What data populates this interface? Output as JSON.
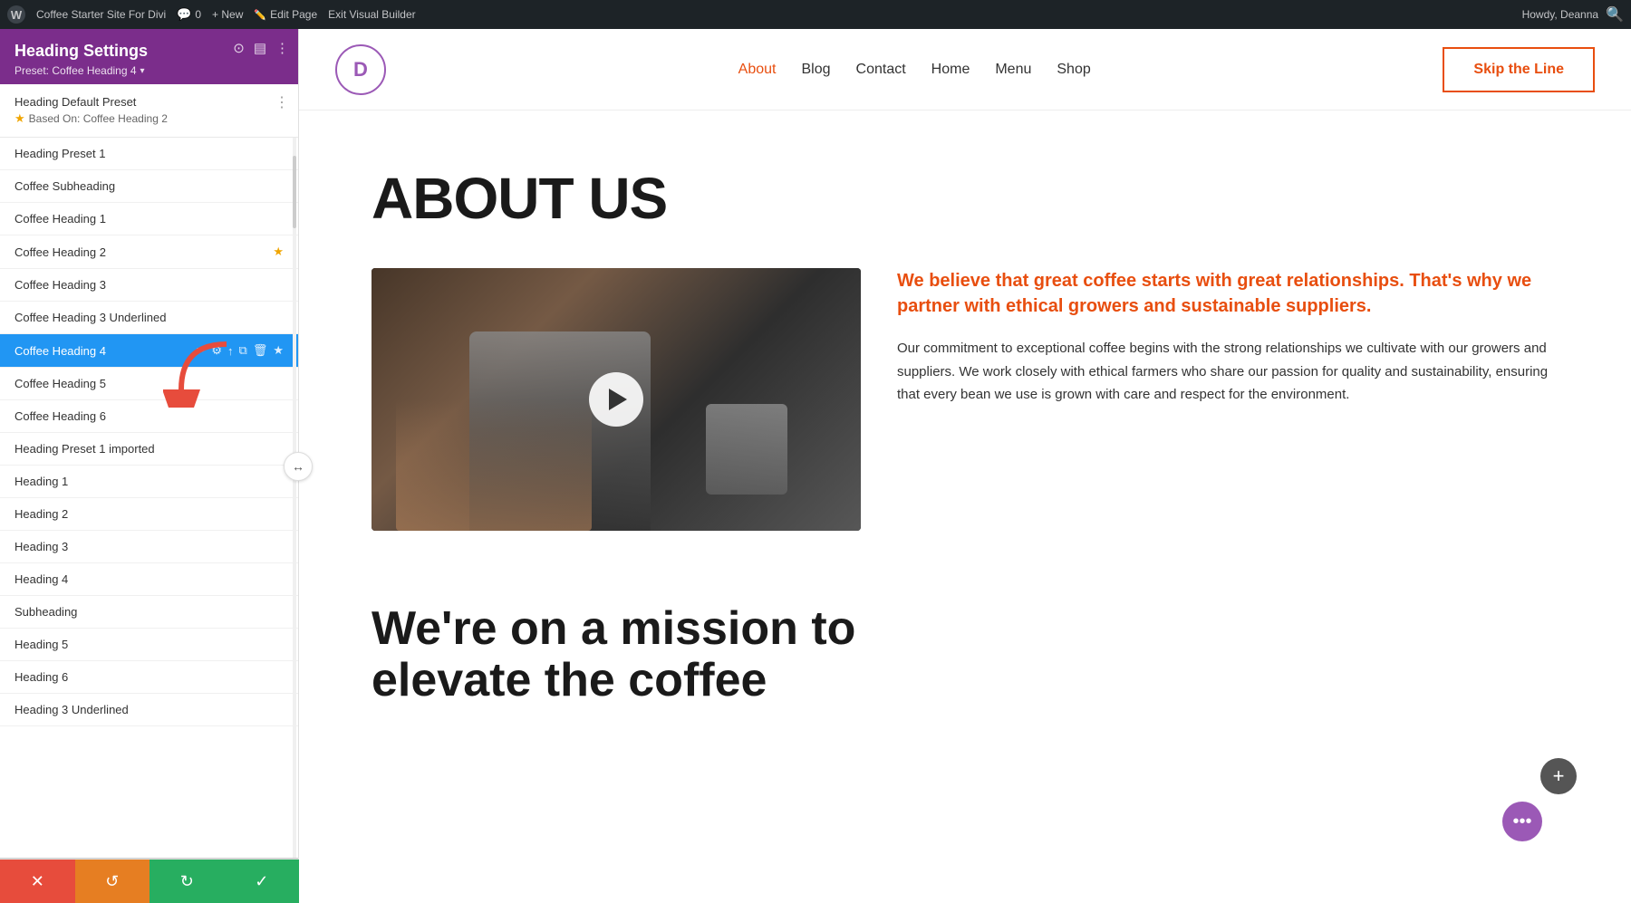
{
  "admin_bar": {
    "wp_label": "W",
    "site_name": "Coffee Starter Site For Divi",
    "comment_count": "0",
    "new_label": "+ New",
    "edit_page": "Edit Page",
    "exit_builder": "Exit Visual Builder",
    "howdy": "Howdy, Deanna"
  },
  "panel": {
    "title": "Heading Settings",
    "preset_label": "Preset: Coffee Heading 4",
    "default_preset_heading": "Heading Default Preset",
    "based_on": "Based On: Coffee Heading 2",
    "presets": [
      {
        "id": 1,
        "label": "Heading Preset 1",
        "active": false,
        "starred": false
      },
      {
        "id": 2,
        "label": "Coffee Subheading",
        "active": false,
        "starred": false
      },
      {
        "id": 3,
        "label": "Coffee Heading 1",
        "active": false,
        "starred": false
      },
      {
        "id": 4,
        "label": "Coffee Heading 2",
        "active": false,
        "starred": true
      },
      {
        "id": 5,
        "label": "Coffee Heading 3",
        "active": false,
        "starred": false
      },
      {
        "id": 6,
        "label": "Coffee Heading 3 Underlined",
        "active": false,
        "starred": false
      },
      {
        "id": 7,
        "label": "Coffee Heading 4",
        "active": true,
        "starred": false
      },
      {
        "id": 8,
        "label": "Coffee Heading 5",
        "active": false,
        "starred": false
      },
      {
        "id": 9,
        "label": "Coffee Heading 6",
        "active": false,
        "starred": false
      },
      {
        "id": 10,
        "label": "Heading Preset 1 imported",
        "active": false,
        "starred": false
      },
      {
        "id": 11,
        "label": "Heading 1",
        "active": false,
        "starred": false
      },
      {
        "id": 12,
        "label": "Heading 2",
        "active": false,
        "starred": false
      },
      {
        "id": 13,
        "label": "Heading 3",
        "active": false,
        "starred": false
      },
      {
        "id": 14,
        "label": "Heading 4",
        "active": false,
        "starred": false
      },
      {
        "id": 15,
        "label": "Subheading",
        "active": false,
        "starred": false
      },
      {
        "id": 16,
        "label": "Heading 5",
        "active": false,
        "starred": false
      },
      {
        "id": 17,
        "label": "Heading 6",
        "active": false,
        "starred": false
      },
      {
        "id": 18,
        "label": "Heading 3 Underlined",
        "active": false,
        "starred": false
      }
    ],
    "active_preset_actions": [
      "edit",
      "settings",
      "apply",
      "duplicate",
      "delete",
      "star"
    ]
  },
  "bottom_bar": {
    "cancel_icon": "✕",
    "undo_icon": "↺",
    "redo_icon": "↻",
    "save_icon": "✓"
  },
  "site": {
    "logo_letter": "D",
    "nav_links": [
      "About",
      "Blog",
      "Contact",
      "Home",
      "Menu",
      "Shop"
    ],
    "active_nav": "About",
    "cta_button": "Skip the Line"
  },
  "page": {
    "heading": "ABOUT US",
    "highlight_text": "We believe that great coffee starts with great relationships. That's why we partner with ethical growers and sustainable suppliers.",
    "body_text": "Our commitment to exceptional coffee begins with the strong relationships we cultivate with our growers and suppliers. We work closely with ethical farmers who share our passion for quality and sustainability, ensuring that every bean we use is grown with care and respect for the environment.",
    "mission_heading_line1": "We're on a mission to",
    "mission_heading_line2": "elevate the coffee"
  }
}
